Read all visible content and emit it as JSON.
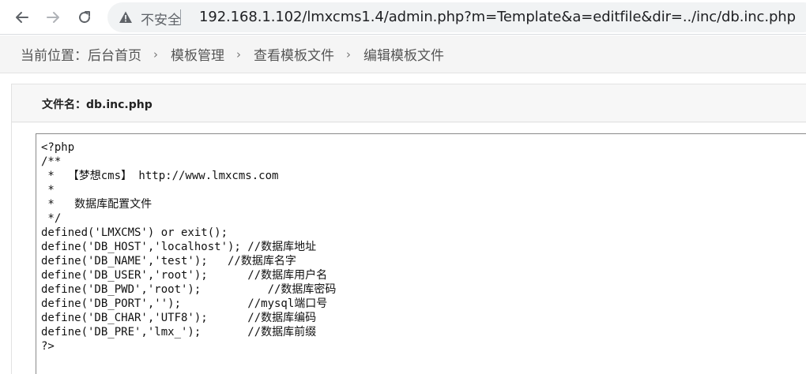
{
  "browser": {
    "security_label": "不安全",
    "url": "192.168.1.102/lmxcms1.4/admin.php?m=Template&a=editfile&dir=../inc/db.inc.php",
    "icons": {
      "back": "arrow-left-icon",
      "forward": "arrow-right-icon",
      "reload": "reload-icon",
      "security": "warning-triangle-icon"
    }
  },
  "breadcrumb": {
    "prefix": "当前位置：",
    "items": [
      "后台首页",
      "模板管理",
      "查看模板文件",
      "编辑模板文件"
    ],
    "separator": "›"
  },
  "editor": {
    "file_label": "文件名：db.inc.php",
    "content": "<?php\n/**\n *  【梦想cms】 http://www.lmxcms.com\n *\n *   数据库配置文件\n */\ndefined('LMXCMS') or exit();\ndefine('DB_HOST','localhost'); //数据库地址\ndefine('DB_NAME','test');   //数据库名字\ndefine('DB_USER','root');      //数据库用户名\ndefine('DB_PWD','root');          //数据库密码\ndefine('DB_PORT','');          //mysql端口号\ndefine('DB_CHAR','UTF8');      //数据库编码\ndefine('DB_PRE','lmx_');       //数据库前缀\n?>"
  },
  "colors": {
    "breadcrumb_bg": "#f5f5f5",
    "panel_bg": "#f7f7f7",
    "omnibox_bg": "#f1f3f4"
  }
}
